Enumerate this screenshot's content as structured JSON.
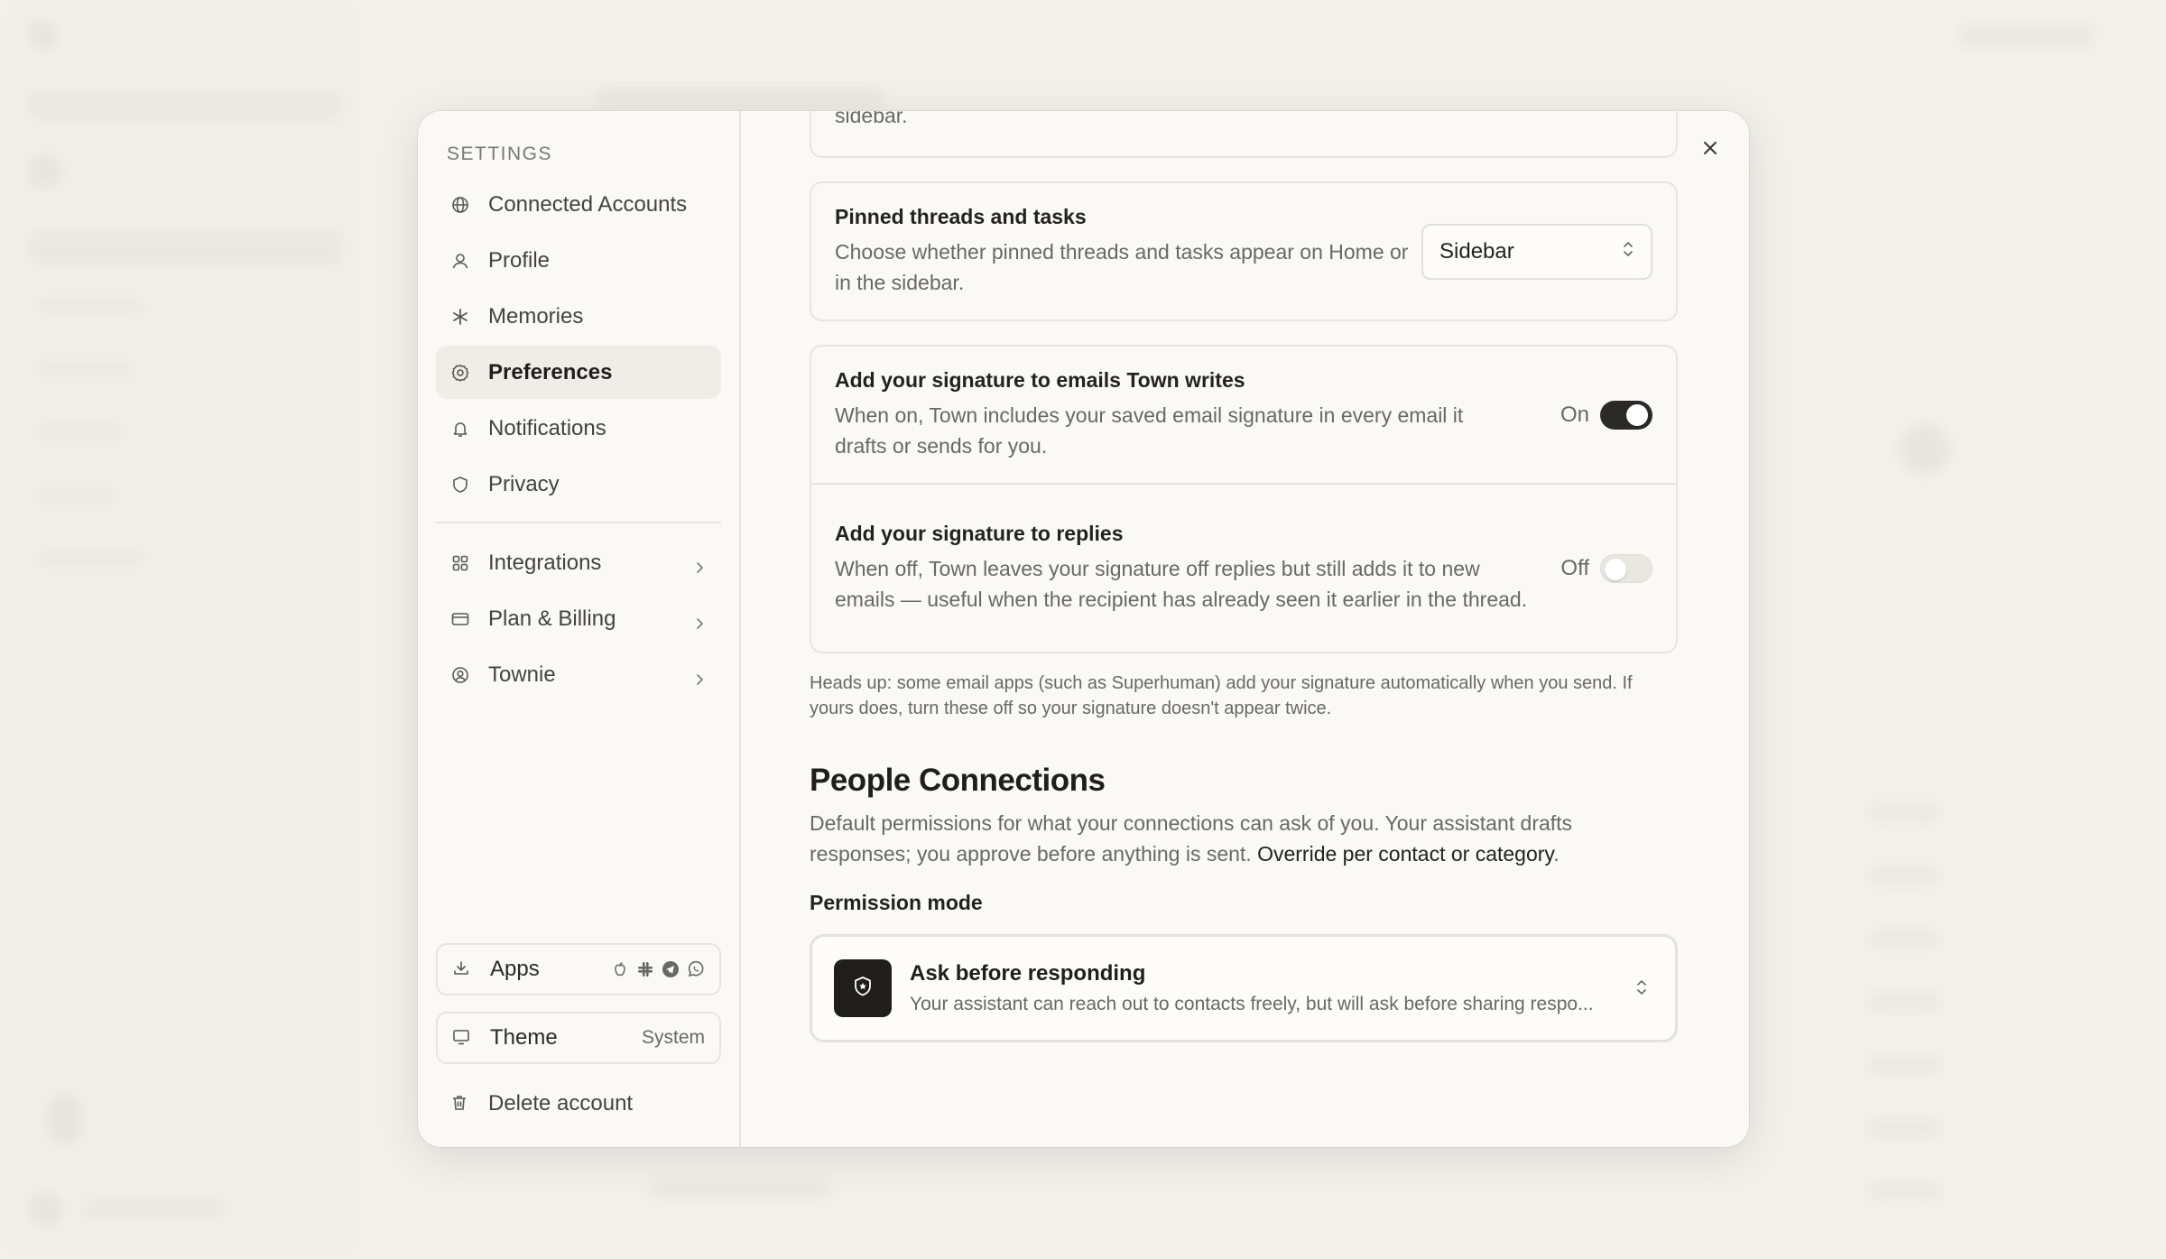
{
  "colors": {
    "accent": "#2b2a28",
    "modal_bg": "#faf9f6",
    "page_bg": "#f3f2ee"
  },
  "nav": {
    "heading": "SETTINGS",
    "items": [
      {
        "label": "Connected Accounts",
        "icon": "globe-icon"
      },
      {
        "label": "Profile",
        "icon": "user-icon"
      },
      {
        "label": "Memories",
        "icon": "asterisk-icon"
      },
      {
        "label": "Preferences",
        "icon": "gear-icon",
        "active": true
      },
      {
        "label": "Notifications",
        "icon": "bell-icon"
      },
      {
        "label": "Privacy",
        "icon": "shield-icon"
      }
    ],
    "secondary": [
      {
        "label": "Integrations",
        "icon": "grid-icon"
      },
      {
        "label": "Plan & Billing",
        "icon": "card-icon"
      },
      {
        "label": "Townie",
        "icon": "at-icon"
      }
    ],
    "apps_label": "Apps",
    "app_icons": [
      "apple-icon",
      "slack-icon",
      "telegram-icon",
      "whatsapp-icon"
    ],
    "theme_label": "Theme",
    "theme_value": "System",
    "delete_label": "Delete account"
  },
  "content": {
    "truncated_prev_text": "sidebar.",
    "pinned": {
      "title": "Pinned threads and tasks",
      "desc": "Choose whether pinned threads and tasks appear on Home or in the sidebar.",
      "select_value": "Sidebar"
    },
    "signature_emails": {
      "title": "Add your signature to emails Town writes",
      "desc": "When on, Town includes your saved email signature in every email it drafts or sends for you.",
      "state_label": "On",
      "on": true
    },
    "signature_replies": {
      "title": "Add your signature to replies",
      "desc": "When off, Town leaves your signature off replies but still adds it to new emails — useful when the recipient has already seen it earlier in the thread.",
      "state_label": "Off",
      "on": false
    },
    "hint": "Heads up: some email apps (such as Superhuman) add your signature automatically when you send. If yours does, turn these off so your signature doesn't appear twice.",
    "people": {
      "title": "People Connections",
      "desc_prefix": "Default permissions for what your connections can ask of you. Your assistant drafts responses; you approve before anything is sent. ",
      "desc_link": "Override per contact or category",
      "desc_suffix": ".",
      "field_label": "Permission mode",
      "mode_title": "Ask before responding",
      "mode_desc": "Your assistant can reach out to contacts freely, but will ask before sharing respo..."
    }
  }
}
